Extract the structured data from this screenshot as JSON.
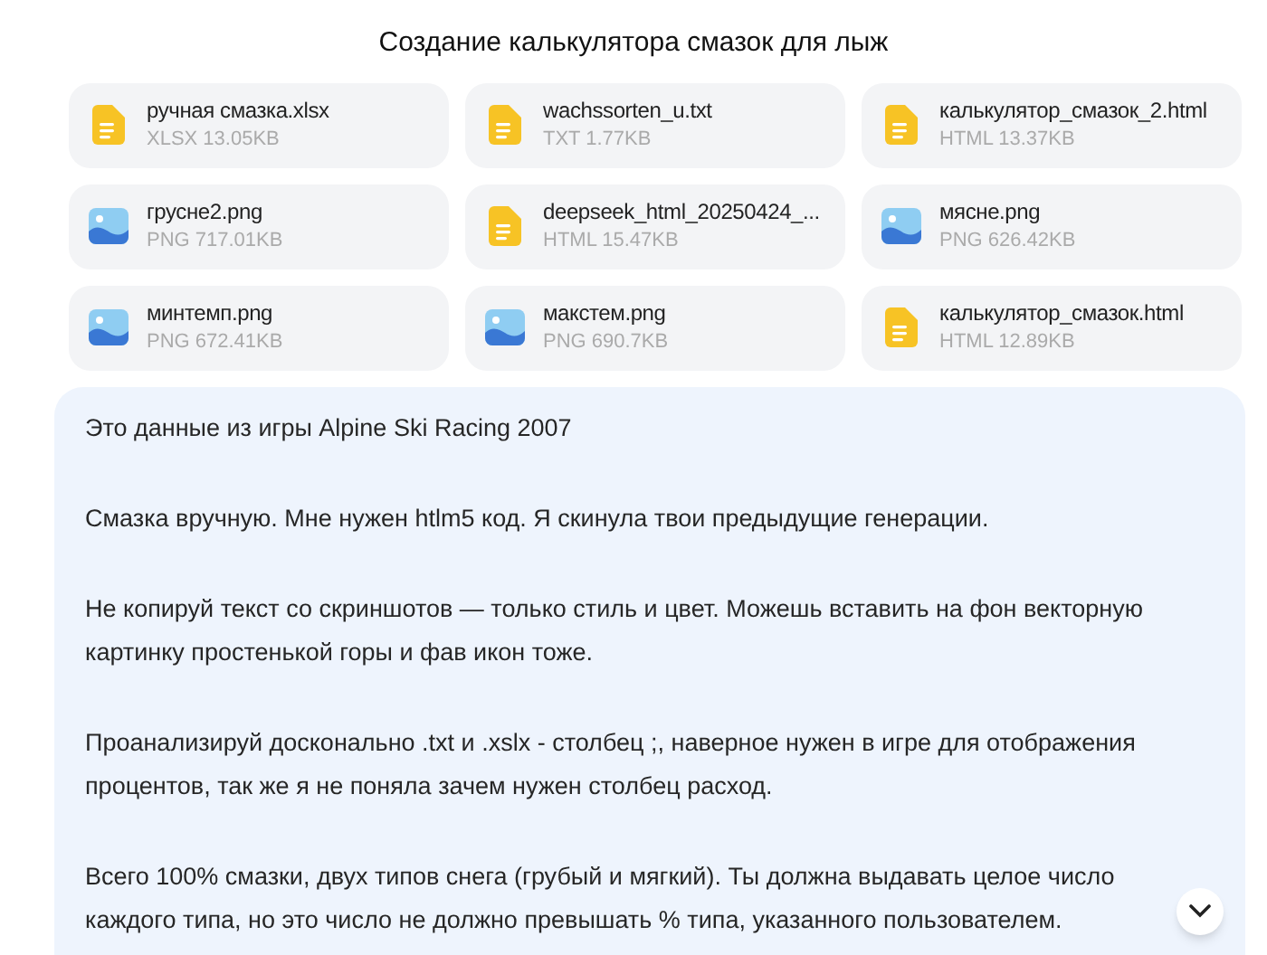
{
  "title": "Создание калькулятора смазок для лыж",
  "files": [
    {
      "kind": "doc",
      "name": "ручная смазка.xlsx",
      "meta": "XLSX 13.05KB"
    },
    {
      "kind": "doc",
      "name": "wachssorten_u.txt",
      "meta": "TXT 1.77KB"
    },
    {
      "kind": "doc",
      "name": "калькулятор_смазок_2.html",
      "meta": "HTML 13.37KB"
    },
    {
      "kind": "image",
      "name": "грусне2.png",
      "meta": "PNG 717.01KB"
    },
    {
      "kind": "doc",
      "name": "deepseek_html_20250424_...",
      "meta": "HTML 15.47KB"
    },
    {
      "kind": "image",
      "name": "мясне.png",
      "meta": "PNG 626.42KB"
    },
    {
      "kind": "image",
      "name": "минтемп.png",
      "meta": "PNG 672.41KB"
    },
    {
      "kind": "image",
      "name": "макстем.png",
      "meta": "PNG 690.7KB"
    },
    {
      "kind": "doc",
      "name": "калькулятор_смазок.html",
      "meta": "HTML 12.89KB"
    }
  ],
  "message": {
    "paragraphs": [
      "Это данные из игры Alpine Ski Racing 2007",
      "Смазка вручную. Мне нужен htlm5 код. Я скинула твои предыдущие генерации.",
      "Не копируй текст со скриншотов — только стиль и цвет. Можешь вставить на фон векторную картинку простенькой горы и фав икон тоже.",
      "Проанализируй досконально .txt и .xslx - столбец ;, наверное нужен в игре для отображения процентов, так же я не поняла зачем нужен столбец расход.",
      "Всего 100% смазки, двух типов снега (грубый и мягкий). Ты должна выдавать целое число каждого типа, но это число не должно превышать % типа, указанного пользователем."
    ]
  }
}
